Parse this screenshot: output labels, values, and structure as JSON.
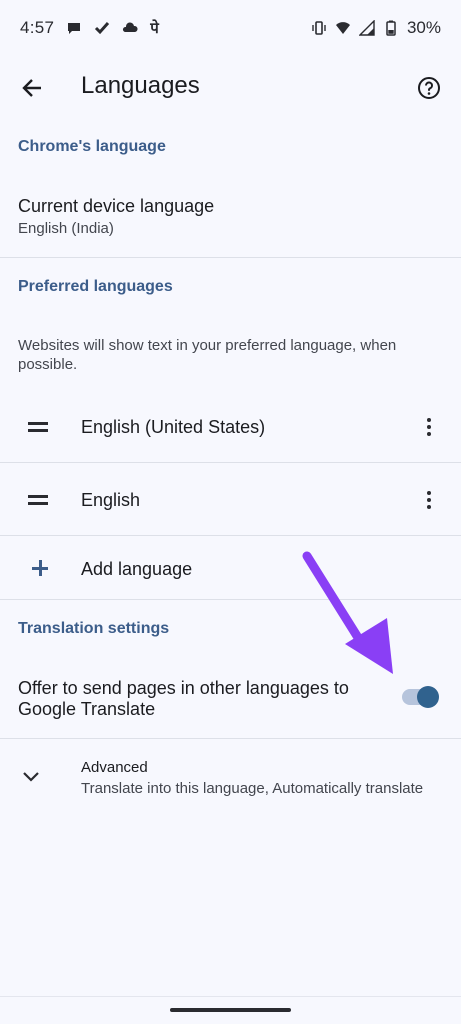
{
  "status_bar": {
    "time": "4:57",
    "battery": "30%",
    "icons_left": [
      "chat-bubble-icon",
      "check-icon",
      "cloud-icon",
      "pe-glyph-icon"
    ],
    "icons_right": [
      "vibrate-icon",
      "wifi-icon",
      "signal-icon",
      "battery-icon"
    ],
    "pe_glyph": "पे"
  },
  "app_bar": {
    "title": "Languages",
    "back_icon": "arrow-left-icon",
    "help_icon": "help-circle-icon"
  },
  "chrome_language": {
    "header": "Chrome's language",
    "current_title": "Current device language",
    "current_value": "English (India)"
  },
  "preferred_languages": {
    "header": "Preferred languages",
    "description": "Websites will show text in your preferred language, when possible.",
    "items": [
      {
        "label": "English (United States)"
      },
      {
        "label": "English"
      }
    ],
    "add_label": "Add language"
  },
  "translation": {
    "header": "Translation settings",
    "offer_label": "Offer to send pages in other languages to Google Translate",
    "offer_enabled": true
  },
  "advanced": {
    "title": "Advanced",
    "subtitle": "Translate into this language, Automatically translate"
  },
  "colors": {
    "background": "#f7f8fe",
    "section_header": "#3c5d8a",
    "toggle_thumb": "#30628e",
    "toggle_track": "#b6c4dc",
    "annotation_arrow": "#8a3ff5"
  }
}
